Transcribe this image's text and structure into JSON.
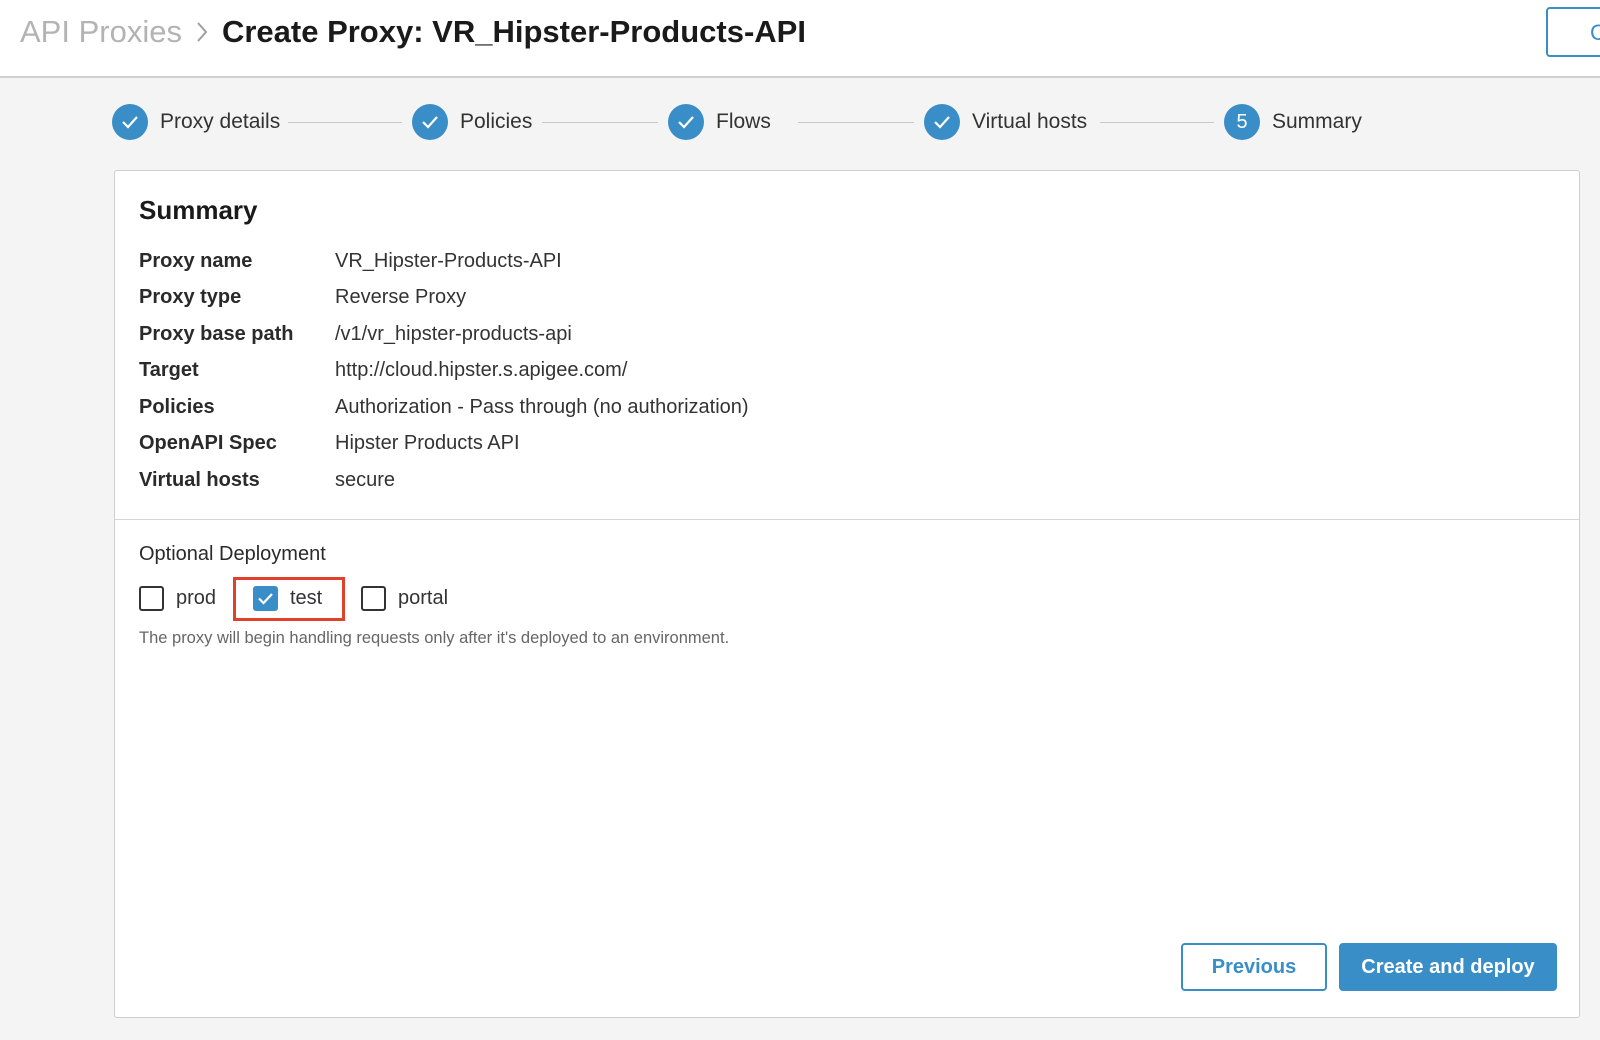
{
  "header": {
    "breadcrumb_link": "API Proxies",
    "title": "Create Proxy: VR_Hipster-Products-API",
    "cut_button_label": "C"
  },
  "stepper": {
    "steps": [
      {
        "label": "Proxy details",
        "state": "complete"
      },
      {
        "label": "Policies",
        "state": "complete"
      },
      {
        "label": "Flows",
        "state": "complete"
      },
      {
        "label": "Virtual hosts",
        "state": "complete"
      },
      {
        "label": "Summary",
        "state": "current",
        "number": "5"
      }
    ]
  },
  "summary": {
    "title": "Summary",
    "rows": [
      {
        "label": "Proxy name",
        "value": "VR_Hipster-Products-API"
      },
      {
        "label": "Proxy type",
        "value": "Reverse Proxy"
      },
      {
        "label": "Proxy base path",
        "value": "/v1/vr_hipster-products-api"
      },
      {
        "label": "Target",
        "value": "http://cloud.hipster.s.apigee.com/"
      },
      {
        "label": "Policies",
        "value": "Authorization - Pass through (no authorization)"
      },
      {
        "label": "OpenAPI Spec",
        "value": "Hipster Products API"
      },
      {
        "label": "Virtual hosts",
        "value": "secure"
      }
    ]
  },
  "deployment": {
    "title": "Optional Deployment",
    "environments": [
      {
        "label": "prod",
        "checked": false
      },
      {
        "label": "test",
        "checked": true
      },
      {
        "label": "portal",
        "checked": false
      }
    ],
    "hint": "The proxy will begin handling requests only after it's deployed to an environment."
  },
  "actions": {
    "previous_label": "Previous",
    "create_label": "Create and deploy"
  },
  "colors": {
    "accent": "#3a8ec8",
    "highlight": "#e0412b"
  }
}
